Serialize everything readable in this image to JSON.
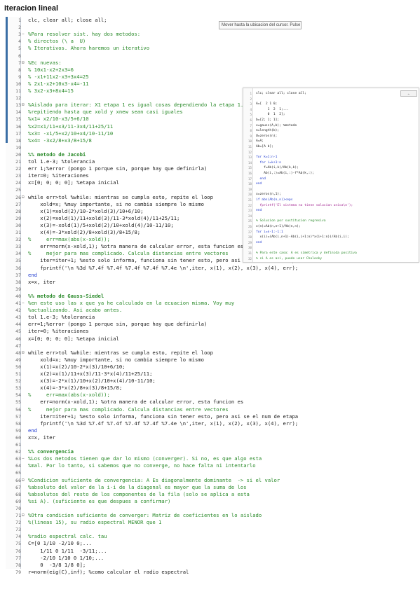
{
  "title": "Iteracion lineal",
  "tooltip": "Mover hasta la ubicacion del cursor. Pulse F10",
  "lines": [
    {
      "n": "1",
      "fold": "",
      "t": "clc, clear all; close all;",
      "cls": ""
    },
    {
      "n": "2",
      "fold": "",
      "t": "",
      "cls": ""
    },
    {
      "n": "3",
      "fold": "−",
      "t": "%Para resolver sist. hay dos metodos:",
      "cls": "c"
    },
    {
      "n": "4",
      "fold": "",
      "t": "% directos (\\ a  U)",
      "cls": "c"
    },
    {
      "n": "5",
      "fold": "",
      "t": "% Iterativos. Ahora haremos un iterativo",
      "cls": "c"
    },
    {
      "n": "6",
      "fold": "",
      "t": "",
      "cls": ""
    },
    {
      "n": "7",
      "fold": "⊟",
      "t": "%Ec nuevas:",
      "cls": "c"
    },
    {
      "n": "8",
      "fold": "",
      "t": "% 10x1-x2+2x3=6",
      "cls": "c"
    },
    {
      "n": "9",
      "fold": "",
      "t": "% -x1+11x2-x3+3x4=25",
      "cls": "c"
    },
    {
      "n": "10",
      "fold": "",
      "t": "% 2x1-x2+10x3-x4=-11",
      "cls": "c"
    },
    {
      "n": "11",
      "fold": "",
      "t": "% 3x2-x3+8x4=15",
      "cls": "c"
    },
    {
      "n": "12",
      "fold": "",
      "t": "",
      "cls": ""
    },
    {
      "n": "13",
      "fold": "⊟",
      "t": "%Aislado para iterar: X1 etapa 1 es igual cosas dependiendo la etapa 1.",
      "cls": "c"
    },
    {
      "n": "14",
      "fold": "",
      "t": "%repitiendo hasta que xold y xnew sean casi iguales",
      "cls": "c"
    },
    {
      "n": "15",
      "fold": "",
      "t": "%x1= x2/10-x3/5+6/10",
      "cls": "c"
    },
    {
      "n": "16",
      "fold": "",
      "t": "%x2=x1/11+x3/11-3x4/11+25/11",
      "cls": "c"
    },
    {
      "n": "17",
      "fold": "",
      "t": "%x3= -x1/5+x2/10+x4/10-11/10",
      "cls": "c"
    },
    {
      "n": "18",
      "fold": "",
      "t": "%x4= -3x2/8+x3/8+15/8",
      "cls": "c"
    },
    {
      "n": "19",
      "fold": "",
      "t": "",
      "cls": ""
    },
    {
      "n": "20",
      "fold": "",
      "t": "%% metodo de Jacobi",
      "cls": "c b"
    },
    {
      "n": "21",
      "fold": "",
      "t": "tol 1.e-3; %tolerancia",
      "cls": "mix1"
    },
    {
      "n": "22",
      "fold": "",
      "t": "err 1;%error (pongo 1 porque sin, porque hay que definirla)",
      "cls": "mix2"
    },
    {
      "n": "23",
      "fold": "",
      "t": "iter=0; %iteraciones",
      "cls": "mix3"
    },
    {
      "n": "24",
      "fold": "",
      "t": "x=[0; 0; 0; 0]; %etapa inicial",
      "cls": "mix4"
    },
    {
      "n": "25",
      "fold": "",
      "t": "",
      "cls": ""
    },
    {
      "n": "26",
      "fold": "⊟",
      "t": "while err>tol %while: mientras se cumpla esto, repite el loop",
      "cls": "wh"
    },
    {
      "n": "27",
      "fold": "",
      "t": "    xold=x; %muy importante, si no cambia siempre lo mismo",
      "cls": "mix5"
    },
    {
      "n": "28",
      "fold": "",
      "t": "    x(1)=xold(2)/10-2*xold(3)/10+6/10;",
      "cls": ""
    },
    {
      "n": "29",
      "fold": "",
      "t": "    x(2)=xold(1)/11+xold(3)/11-3*xold(4)/11+25/11;",
      "cls": ""
    },
    {
      "n": "30",
      "fold": "",
      "t": "    x(3)=-xold(1)/5+xold(2)/10+xold(4)/10-11/10;",
      "cls": ""
    },
    {
      "n": "31",
      "fold": "",
      "t": "    x(4)=-3*xold(2)/8+xold(3)/8+15/8;",
      "cls": ""
    },
    {
      "n": "32",
      "fold": "",
      "t": "%     err=max(abs(x-xold));",
      "cls": "c"
    },
    {
      "n": "33",
      "fold": "",
      "t": "    err=norm(x-xold,1); %otra manera de calcular error, esta funcion es",
      "cls": "mix6"
    },
    {
      "n": "34",
      "fold": "",
      "t": "%     mejor para mas complicado. Calcula distancias entre vectores",
      "cls": "c"
    },
    {
      "n": "35",
      "fold": "",
      "t": "    iter=iter+1; %esto solo informa, funciona sin tener esto, pero asi se el num de etapa",
      "cls": "mix7"
    },
    {
      "n": "36",
      "fold": "",
      "t": "    fprintf('\\n %3d %7.4f %7.4f %7.4f %7.4f %7.4e \\n',iter, x(1), x(2), x(3), x(4), err);",
      "cls": "pf"
    },
    {
      "n": "37",
      "fold": "",
      "t": "end",
      "cls": "k"
    },
    {
      "n": "38",
      "fold": "",
      "t": "x=x, iter",
      "cls": ""
    },
    {
      "n": "39",
      "fold": "",
      "t": "",
      "cls": ""
    },
    {
      "n": "40",
      "fold": "",
      "t": "%% metodo de Gauss-Siedel",
      "cls": "c b"
    },
    {
      "n": "41",
      "fold": "−",
      "t": "%en este uso las x que ya he calculado en la ecuacion misma. Voy muy",
      "cls": "c"
    },
    {
      "n": "42",
      "fold": "",
      "t": "%actualizando. Asi acabo antes.",
      "cls": "c"
    },
    {
      "n": "43",
      "fold": "",
      "t": "tol 1.e-3; %tolerancia",
      "cls": "mix1"
    },
    {
      "n": "44",
      "fold": "",
      "t": "err=1;%error (pongo 1 porque sin, porque hay que definirla)",
      "cls": "mix2"
    },
    {
      "n": "45",
      "fold": "",
      "t": "iter=0; %iteraciones",
      "cls": "mix3"
    },
    {
      "n": "46",
      "fold": "",
      "t": "x=[0; 0; 0; 0]; %etapa inicial",
      "cls": "mix4"
    },
    {
      "n": "47",
      "fold": "",
      "t": "",
      "cls": ""
    },
    {
      "n": "48",
      "fold": "⊟",
      "t": "while err>tol %while: mientras se cumpla esto, repite el loop",
      "cls": "wh"
    },
    {
      "n": "49",
      "fold": "",
      "t": "    xold=x; %muy importante, si no cambia siempre lo mismo",
      "cls": "mix5"
    },
    {
      "n": "50",
      "fold": "",
      "t": "    x(1)=x(2)/10-2*x(3)/10+6/10;",
      "cls": ""
    },
    {
      "n": "51",
      "fold": "",
      "t": "    x(2)=x(1)/11+x(3)/11-3*x(4)/11+25/11;",
      "cls": ""
    },
    {
      "n": "52",
      "fold": "",
      "t": "    x(3)=-2*x(1)/10+x(2)/10+x(4)/10-11/10;",
      "cls": ""
    },
    {
      "n": "53",
      "fold": "",
      "t": "    x(4)=-3*x(2)/8+x(3)/8+15/8;",
      "cls": ""
    },
    {
      "n": "54",
      "fold": "",
      "t": "%     err=max(abs(x-xold));",
      "cls": "c"
    },
    {
      "n": "55",
      "fold": "",
      "t": "    err=norm(x-xold,1); %otra manera de calcular error, esta funcion es",
      "cls": "mix6"
    },
    {
      "n": "56",
      "fold": "",
      "t": "%     mejor para mas complicado. Calcula distancias entre vectores",
      "cls": "c"
    },
    {
      "n": "57",
      "fold": "",
      "t": "    iter=iter+1; %esto solo informa, funciona sin tener esto, pero asi se el num de etapa",
      "cls": "mix7"
    },
    {
      "n": "58",
      "fold": "",
      "t": "    fprintf('\\n %3d %7.4f %7.4f %7.4f %7.4f %7.4e \\n',iter, x(1), x(2), x(3), x(4), err);",
      "cls": "pf"
    },
    {
      "n": "59",
      "fold": "",
      "t": "end",
      "cls": "k"
    },
    {
      "n": "60",
      "fold": "",
      "t": "x=x, iter",
      "cls": ""
    },
    {
      "n": "61",
      "fold": "",
      "t": "",
      "cls": ""
    },
    {
      "n": "62",
      "fold": "",
      "t": "%% convergencia",
      "cls": "c b"
    },
    {
      "n": "63",
      "fold": "−",
      "t": "%Los dos metodos tienen que dar lo mismo (converger). Si no, es que algo esta",
      "cls": "c"
    },
    {
      "n": "64",
      "fold": "",
      "t": "%mal. Por lo tanto, si sabemos que no converge, no hace falta ni intentarlo",
      "cls": "c"
    },
    {
      "n": "65",
      "fold": "",
      "t": "",
      "cls": ""
    },
    {
      "n": "66",
      "fold": "⊟",
      "t": "%Condicion suficiente de convergencia: A Es diagonalmente dominante  -> si el valor",
      "cls": "c"
    },
    {
      "n": "67",
      "fold": "",
      "t": "%absoluto del valor de la i-i de la diagonal es mayor que la suma de los",
      "cls": "c"
    },
    {
      "n": "68",
      "fold": "",
      "t": "%absolutos del resto de los componentes de la fila (solo se aplica a esta",
      "cls": "c"
    },
    {
      "n": "69",
      "fold": "",
      "t": "%si A). (suficiente es que despues a confirmar)",
      "cls": "c"
    },
    {
      "n": "70",
      "fold": "",
      "t": "",
      "cls": ""
    },
    {
      "n": "71",
      "fold": "⊟",
      "t": "%Otra condicion suficiente de converger: Matriz de coeficientes en lo aislado",
      "cls": "c"
    },
    {
      "n": "72",
      "fold": "",
      "t": "%(lineas 15), su radio espectral MENOR que 1",
      "cls": "c"
    },
    {
      "n": "73",
      "fold": "",
      "t": "",
      "cls": ""
    },
    {
      "n": "74",
      "fold": "",
      "t": "%radio espectral calc. tau",
      "cls": "c"
    },
    {
      "n": "75",
      "fold": "",
      "t": "C=[0 1/10 -2/10 0;...",
      "cls": ""
    },
    {
      "n": "76",
      "fold": "",
      "t": "    1/11 0 1/11  -3/11;...",
      "cls": ""
    },
    {
      "n": "77",
      "fold": "",
      "t": "    -2/10 1/10 0 1/10;...",
      "cls": ""
    },
    {
      "n": "78",
      "fold": "",
      "t": "    0  -3/8 1/8 0];",
      "cls": ""
    },
    {
      "n": "79",
      "fold": "",
      "t": "r=norm(eig(C),inf); %como calcular el radio espectral",
      "cls": "mix8"
    }
  ],
  "inset": {
    "button": "←",
    "lines": [
      {
        "n": "1",
        "t": "clc; clear all; close all;",
        "cls": ""
      },
      {
        "n": "2",
        "t": "",
        "cls": ""
      },
      {
        "n": "3",
        "t": "A=[  2 1 0;",
        "cls": ""
      },
      {
        "n": "4",
        "t": "      1  2  1;...",
        "cls": ""
      },
      {
        "n": "5",
        "t": "      0  1  2];",
        "cls": ""
      },
      {
        "n": "6",
        "t": "b=[2; 1; 1];",
        "cls": ""
      },
      {
        "n": "7",
        "t": "x=gauss(A,b); %metodo",
        "cls": ""
      },
      {
        "n": "8",
        "t": "n=length(b);",
        "cls": ""
      },
      {
        "n": "9",
        "t": "U=zeros(n);",
        "cls": ""
      },
      {
        "n": "10",
        "t": "A=A;",
        "cls": ""
      },
      {
        "n": "11",
        "t": "Ab=[A b];",
        "cls": ""
      },
      {
        "n": "12",
        "t": "",
        "cls": ""
      },
      {
        "n": "13",
        "t": "for k=1:n-1",
        "cls": "k"
      },
      {
        "n": "14",
        "t": "  for i=k+1:n",
        "cls": "k"
      },
      {
        "n": "15",
        "t": "    f=Ab(i,k)/Ab(k,k);",
        "cls": ""
      },
      {
        "n": "16",
        "t": "    Ab(i,:)=Ab(i,:)-f*Ab(k,:);",
        "cls": ""
      },
      {
        "n": "17",
        "t": "  end",
        "cls": "k"
      },
      {
        "n": "18",
        "t": "end",
        "cls": "k"
      },
      {
        "n": "19",
        "t": "",
        "cls": ""
      },
      {
        "n": "20",
        "t": "x=zeros(n,1);",
        "cls": ""
      },
      {
        "n": "21",
        "t": "if abs(Ab(n,n))<eps",
        "cls": "k"
      },
      {
        "n": "22",
        "t": "  fprintf('El sistema no tiene solucion unica\\n');",
        "cls": "s"
      },
      {
        "n": "23",
        "t": "end",
        "cls": "k"
      },
      {
        "n": "24",
        "t": "",
        "cls": ""
      },
      {
        "n": "25",
        "t": "% Solucion por sustitucion regresiva",
        "cls": "c"
      },
      {
        "n": "26",
        "t": "x(n)=Ab(n,n+1)/Ab(n,n);",
        "cls": ""
      },
      {
        "n": "27",
        "t": "for i=n-1:-1:1",
        "cls": "k"
      },
      {
        "n": "28",
        "t": "  x(i)=(Ab(i,n+1)-Ab(i,i+1:n)*x(i+1:n))/Ab(i,i);",
        "cls": ""
      },
      {
        "n": "29",
        "t": "end",
        "cls": "k"
      },
      {
        "n": "30",
        "t": "",
        "cls": ""
      },
      {
        "n": "31",
        "t": "% Para este caso: A es simetrica y definida positiva",
        "cls": "c"
      },
      {
        "n": "32",
        "t": "% si A es asi, puede usar Cholesky",
        "cls": "c"
      }
    ]
  }
}
